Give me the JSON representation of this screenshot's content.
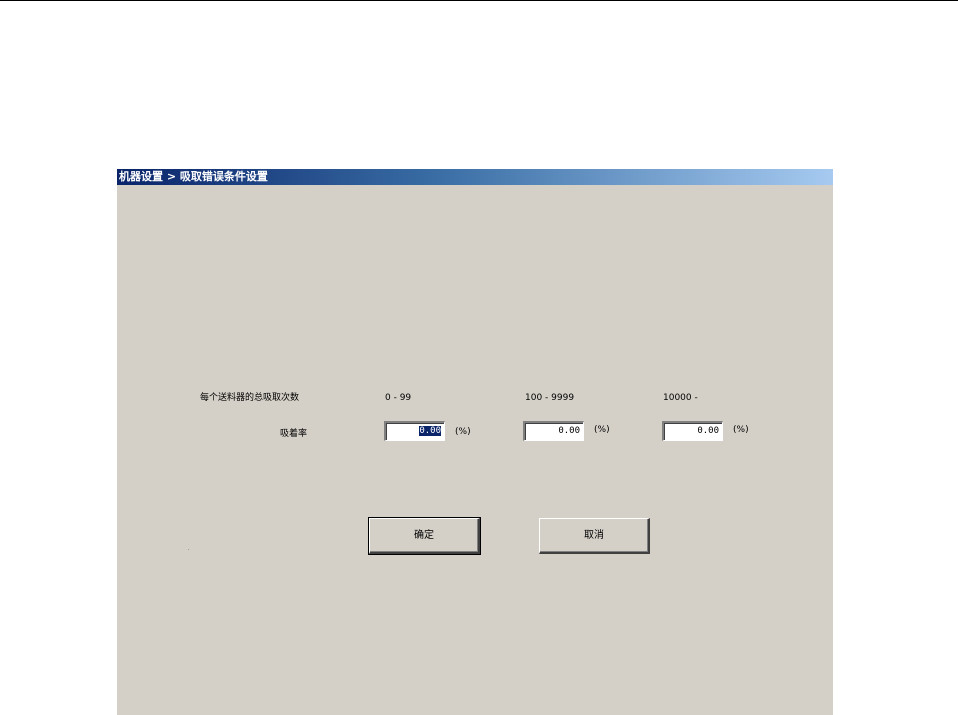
{
  "window": {
    "title": "机器设置 > 吸取错误条件设置"
  },
  "form": {
    "row_header_label": "每个送料器的总吸取次数",
    "ranges": [
      "0 - 99",
      "100 - 9999",
      "10000 -"
    ],
    "rate_label": "吸着率",
    "values": [
      "0.00",
      "0.00",
      "0.00"
    ],
    "unit": "(%)"
  },
  "buttons": {
    "ok_label": "确定",
    "cancel_label": "取消"
  },
  "colors": {
    "dialog_bg": "#d4d0c8",
    "title_start": "#0a246a",
    "title_end": "#a6caf0"
  }
}
